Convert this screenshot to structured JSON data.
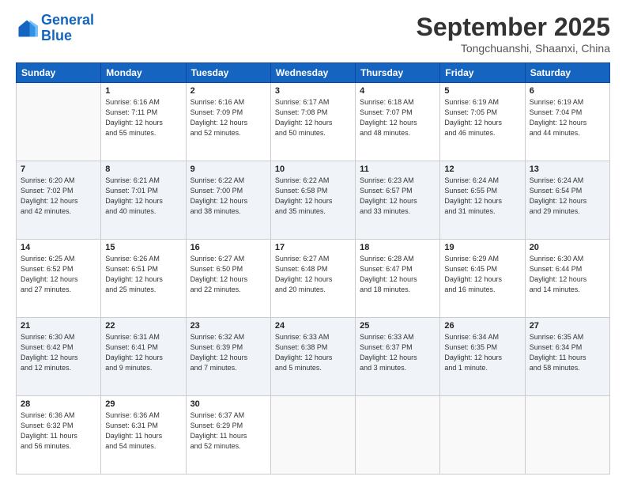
{
  "logo": {
    "line1": "General",
    "line2": "Blue"
  },
  "header": {
    "month": "September 2025",
    "location": "Tongchuanshi, Shaanxi, China"
  },
  "weekdays": [
    "Sunday",
    "Monday",
    "Tuesday",
    "Wednesday",
    "Thursday",
    "Friday",
    "Saturday"
  ],
  "weeks": [
    [
      {
        "day": "",
        "info": ""
      },
      {
        "day": "1",
        "info": "Sunrise: 6:16 AM\nSunset: 7:11 PM\nDaylight: 12 hours\nand 55 minutes."
      },
      {
        "day": "2",
        "info": "Sunrise: 6:16 AM\nSunset: 7:09 PM\nDaylight: 12 hours\nand 52 minutes."
      },
      {
        "day": "3",
        "info": "Sunrise: 6:17 AM\nSunset: 7:08 PM\nDaylight: 12 hours\nand 50 minutes."
      },
      {
        "day": "4",
        "info": "Sunrise: 6:18 AM\nSunset: 7:07 PM\nDaylight: 12 hours\nand 48 minutes."
      },
      {
        "day": "5",
        "info": "Sunrise: 6:19 AM\nSunset: 7:05 PM\nDaylight: 12 hours\nand 46 minutes."
      },
      {
        "day": "6",
        "info": "Sunrise: 6:19 AM\nSunset: 7:04 PM\nDaylight: 12 hours\nand 44 minutes."
      }
    ],
    [
      {
        "day": "7",
        "info": "Sunrise: 6:20 AM\nSunset: 7:02 PM\nDaylight: 12 hours\nand 42 minutes."
      },
      {
        "day": "8",
        "info": "Sunrise: 6:21 AM\nSunset: 7:01 PM\nDaylight: 12 hours\nand 40 minutes."
      },
      {
        "day": "9",
        "info": "Sunrise: 6:22 AM\nSunset: 7:00 PM\nDaylight: 12 hours\nand 38 minutes."
      },
      {
        "day": "10",
        "info": "Sunrise: 6:22 AM\nSunset: 6:58 PM\nDaylight: 12 hours\nand 35 minutes."
      },
      {
        "day": "11",
        "info": "Sunrise: 6:23 AM\nSunset: 6:57 PM\nDaylight: 12 hours\nand 33 minutes."
      },
      {
        "day": "12",
        "info": "Sunrise: 6:24 AM\nSunset: 6:55 PM\nDaylight: 12 hours\nand 31 minutes."
      },
      {
        "day": "13",
        "info": "Sunrise: 6:24 AM\nSunset: 6:54 PM\nDaylight: 12 hours\nand 29 minutes."
      }
    ],
    [
      {
        "day": "14",
        "info": "Sunrise: 6:25 AM\nSunset: 6:52 PM\nDaylight: 12 hours\nand 27 minutes."
      },
      {
        "day": "15",
        "info": "Sunrise: 6:26 AM\nSunset: 6:51 PM\nDaylight: 12 hours\nand 25 minutes."
      },
      {
        "day": "16",
        "info": "Sunrise: 6:27 AM\nSunset: 6:50 PM\nDaylight: 12 hours\nand 22 minutes."
      },
      {
        "day": "17",
        "info": "Sunrise: 6:27 AM\nSunset: 6:48 PM\nDaylight: 12 hours\nand 20 minutes."
      },
      {
        "day": "18",
        "info": "Sunrise: 6:28 AM\nSunset: 6:47 PM\nDaylight: 12 hours\nand 18 minutes."
      },
      {
        "day": "19",
        "info": "Sunrise: 6:29 AM\nSunset: 6:45 PM\nDaylight: 12 hours\nand 16 minutes."
      },
      {
        "day": "20",
        "info": "Sunrise: 6:30 AM\nSunset: 6:44 PM\nDaylight: 12 hours\nand 14 minutes."
      }
    ],
    [
      {
        "day": "21",
        "info": "Sunrise: 6:30 AM\nSunset: 6:42 PM\nDaylight: 12 hours\nand 12 minutes."
      },
      {
        "day": "22",
        "info": "Sunrise: 6:31 AM\nSunset: 6:41 PM\nDaylight: 12 hours\nand 9 minutes."
      },
      {
        "day": "23",
        "info": "Sunrise: 6:32 AM\nSunset: 6:39 PM\nDaylight: 12 hours\nand 7 minutes."
      },
      {
        "day": "24",
        "info": "Sunrise: 6:33 AM\nSunset: 6:38 PM\nDaylight: 12 hours\nand 5 minutes."
      },
      {
        "day": "25",
        "info": "Sunrise: 6:33 AM\nSunset: 6:37 PM\nDaylight: 12 hours\nand 3 minutes."
      },
      {
        "day": "26",
        "info": "Sunrise: 6:34 AM\nSunset: 6:35 PM\nDaylight: 12 hours\nand 1 minute."
      },
      {
        "day": "27",
        "info": "Sunrise: 6:35 AM\nSunset: 6:34 PM\nDaylight: 11 hours\nand 58 minutes."
      }
    ],
    [
      {
        "day": "28",
        "info": "Sunrise: 6:36 AM\nSunset: 6:32 PM\nDaylight: 11 hours\nand 56 minutes."
      },
      {
        "day": "29",
        "info": "Sunrise: 6:36 AM\nSunset: 6:31 PM\nDaylight: 11 hours\nand 54 minutes."
      },
      {
        "day": "30",
        "info": "Sunrise: 6:37 AM\nSunset: 6:29 PM\nDaylight: 11 hours\nand 52 minutes."
      },
      {
        "day": "",
        "info": ""
      },
      {
        "day": "",
        "info": ""
      },
      {
        "day": "",
        "info": ""
      },
      {
        "day": "",
        "info": ""
      }
    ]
  ]
}
